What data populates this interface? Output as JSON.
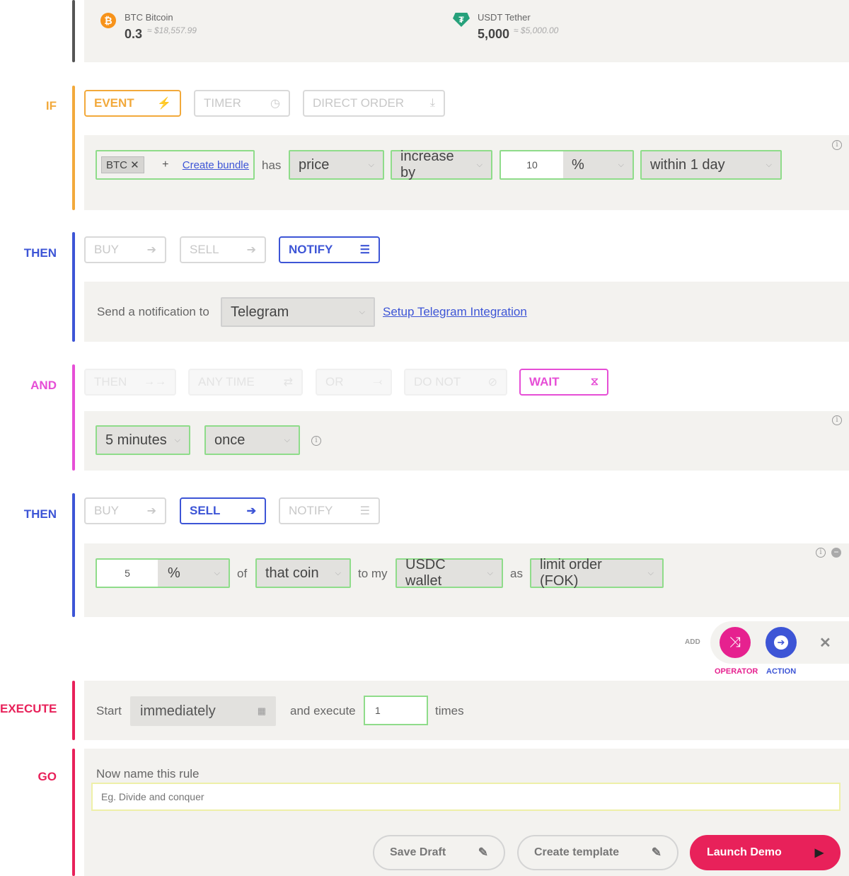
{
  "wallet": {
    "btc": {
      "name": "BTC Bitcoin",
      "amount": "0.3",
      "fiat": "≈ $18,557.99"
    },
    "usdt": {
      "name": "USDT Tether",
      "amount": "5,000",
      "fiat": "≈ $5,000.00"
    }
  },
  "if_section": {
    "label": "IF",
    "tabs": {
      "event": "EVENT",
      "timer": "TIMER",
      "direct_order": "DIRECT ORDER"
    },
    "coin_tag": "BTC",
    "create_bundle": "Create bundle",
    "has": "has",
    "metric": "price",
    "direction": "increase by",
    "amount": "10",
    "unit": "%",
    "timeframe": "within 1 day"
  },
  "then1": {
    "label": "THEN",
    "tabs": {
      "buy": "BUY",
      "sell": "SELL",
      "notify": "NOTIFY"
    },
    "send_text": "Send a notification to",
    "channel": "Telegram",
    "setup_link": "Setup Telegram Integration"
  },
  "and_section": {
    "label": "AND",
    "tabs": {
      "then": "THEN",
      "any_time": "ANY TIME",
      "or": "OR",
      "do_not": "DO NOT",
      "wait": "WAIT"
    },
    "duration": "5 minutes",
    "frequency": "once"
  },
  "then2": {
    "label": "THEN",
    "tabs": {
      "buy": "BUY",
      "sell": "SELL",
      "notify": "NOTIFY"
    },
    "amount": "5",
    "unit": "%",
    "of": "of",
    "coin": "that coin",
    "to_my": "to my",
    "wallet": "USDC wallet",
    "as": "as",
    "order_type": "limit order (FOK)"
  },
  "add_bar": {
    "add": "ADD",
    "operator": "OPERATOR",
    "action": "ACTION"
  },
  "execute": {
    "label": "EXECUTE",
    "start": "Start",
    "start_value": "immediately",
    "and_execute": "and execute",
    "times_value": "1",
    "times": "times"
  },
  "go": {
    "label": "GO",
    "name_prompt": "Now name this rule",
    "name_placeholder": "Eg. Divide and conquer",
    "save_draft": "Save Draft",
    "create_template": "Create template",
    "launch": "Launch Demo"
  },
  "colors": {
    "if": "#f2a93b",
    "then": "#3d55d6",
    "and": "#e64ed6",
    "execute": "#e8215a",
    "green_border": "#8fdc8a"
  }
}
